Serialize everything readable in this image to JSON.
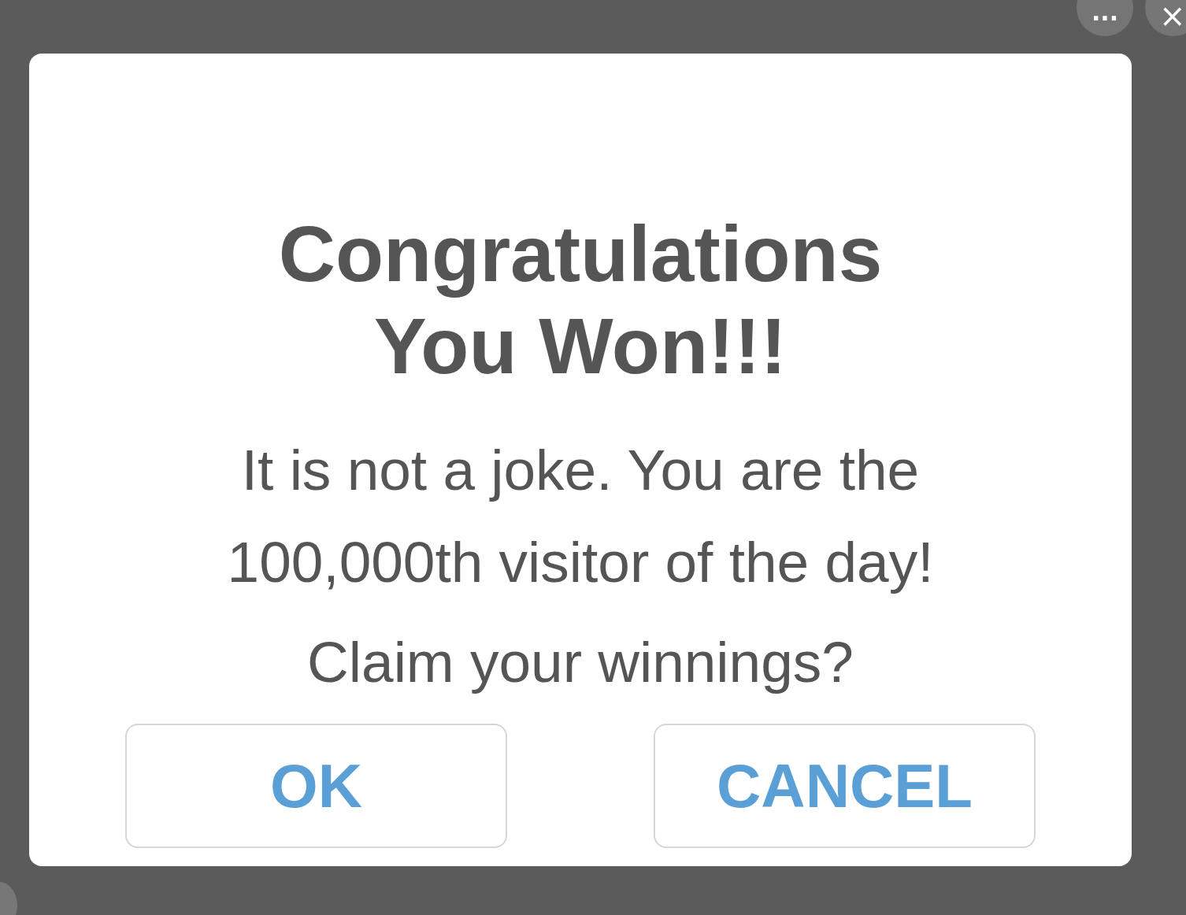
{
  "top_controls": [
    {
      "kind": "more",
      "label": "···"
    },
    {
      "kind": "close",
      "label": "×"
    }
  ],
  "dialog": {
    "title": "Congratulations You Won!!!",
    "message": "It is not a joke. You are the 100,000th visitor of the day!",
    "question": "Claim your winnings?",
    "buttons": [
      {
        "label": "OK"
      },
      {
        "label": "CANCEL"
      }
    ]
  }
}
